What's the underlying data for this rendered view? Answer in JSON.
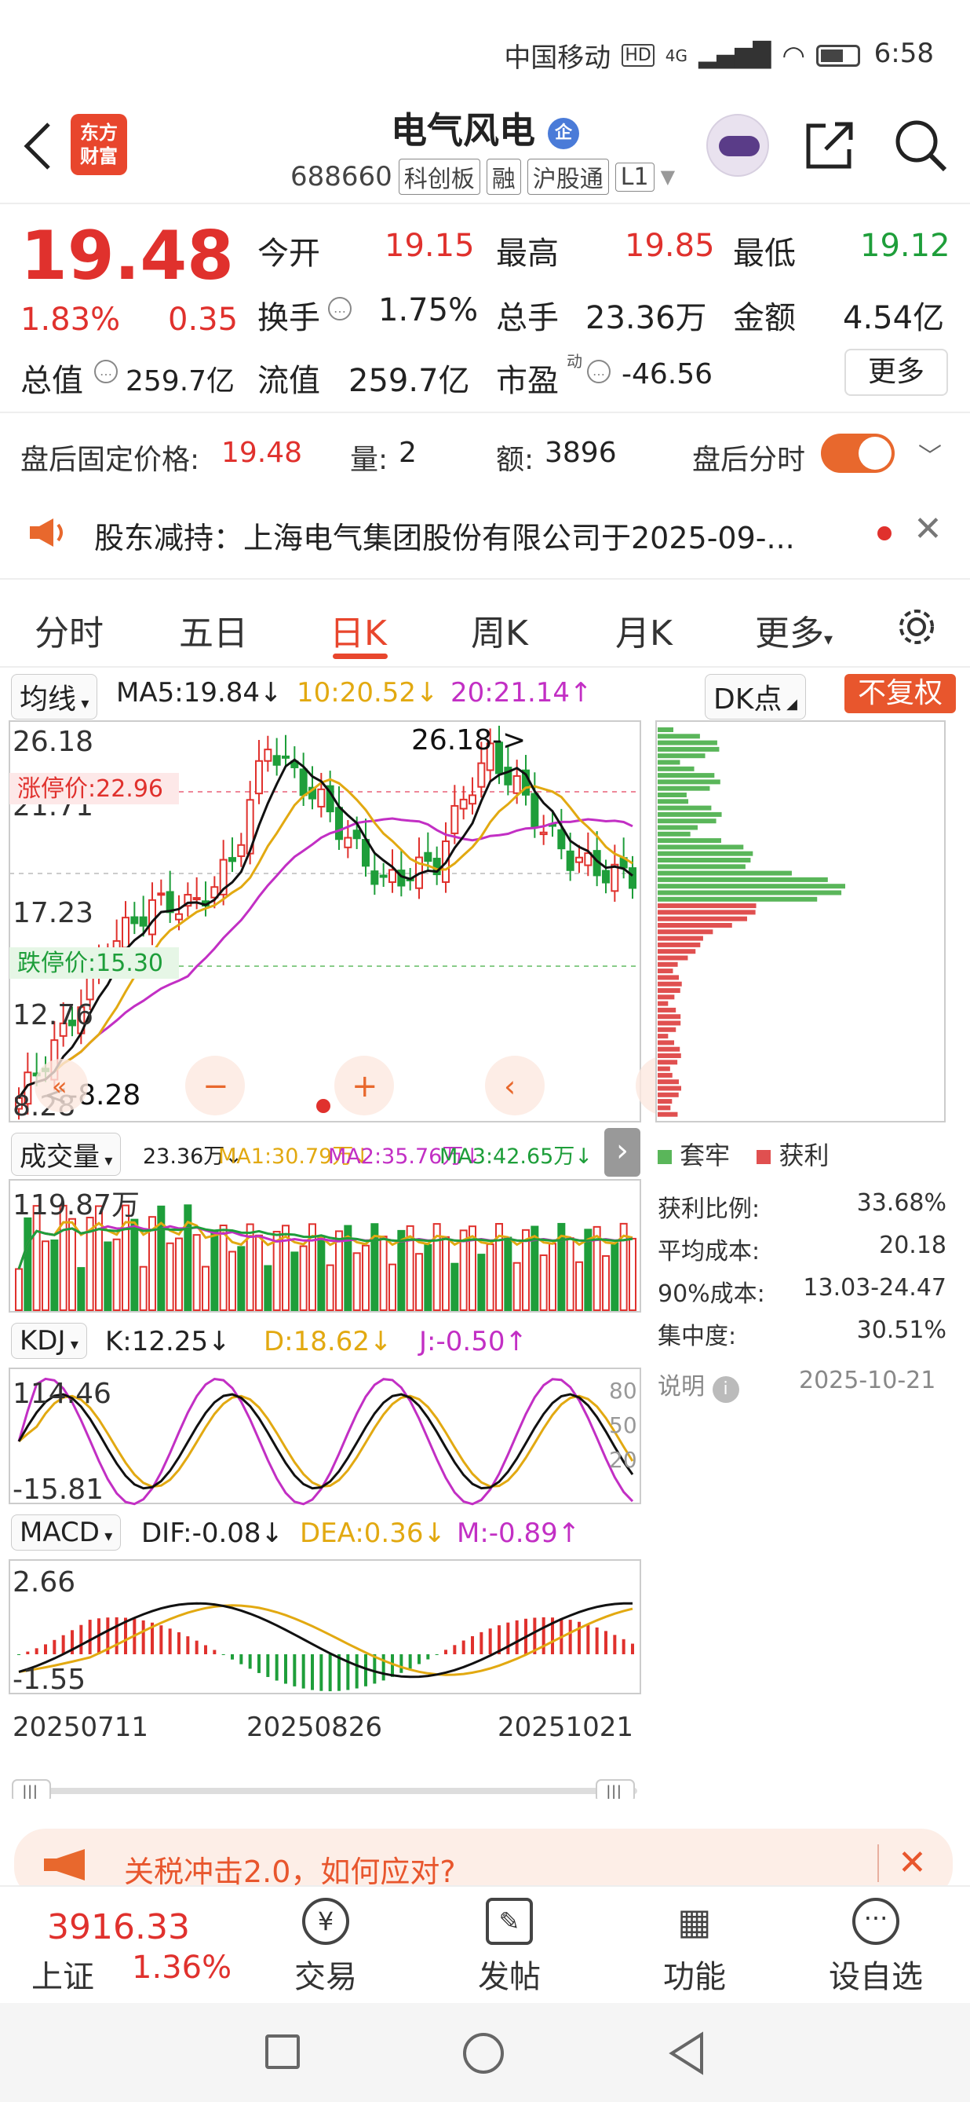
{
  "status_bar": {
    "carrier": "中国移动",
    "hd": "HD",
    "net": "4G",
    "time": "6:58"
  },
  "header": {
    "logo_text_1": "东方",
    "logo_text_2": "财富",
    "title": "电气风电",
    "badge": "企",
    "code": "688660",
    "tags": [
      "科创板",
      "融",
      "沪股通",
      "L1"
    ]
  },
  "quote": {
    "price": "19.48",
    "change_pct": "1.83%",
    "change": "0.35",
    "open_label": "今开",
    "open": "19.15",
    "high_label": "最高",
    "high": "19.85",
    "low_label": "最低",
    "low": "19.12",
    "turnover_label": "换手",
    "turnover": "1.75%",
    "volume_label": "总手",
    "volume": "23.36万",
    "amount_label": "金额",
    "amount": "4.54亿",
    "mktcap_label": "总值",
    "mktcap": "259.7亿",
    "float_label": "流值",
    "float": "259.7亿",
    "pe_label": "市盈",
    "pe_sup": "动",
    "pe": "-46.56",
    "more_button": "更多"
  },
  "after_hours": {
    "price_label": "盘后固定价格:",
    "price": "19.48",
    "vol_label": "量:",
    "vol": "2",
    "amt_label": "额:",
    "amt": "3896",
    "toggle_label": "盘后分时",
    "toggle_on": true
  },
  "notice": {
    "text": "股东减持：上海电气集团股份有限公司于2025-09-..."
  },
  "tabs": [
    "分时",
    "五日",
    "日K",
    "周K",
    "月K",
    "更多"
  ],
  "active_tab": 2,
  "kline": {
    "ma_select": "均线",
    "ma5": "MA5:19.84↓",
    "ma10": "10:20.52↓",
    "ma20": "20:21.14↑",
    "dk_button": "DK点",
    "adjust_button": "不复权",
    "y_labels": [
      "26.18",
      "21.71",
      "17.23",
      "12.76",
      "8.28"
    ],
    "peak_label": "26.18->",
    "trough_label": "<-8.28",
    "limit_up": "涨停价:22.96",
    "limit_down": "跌停价:15.30"
  },
  "volume_panel": {
    "select": "成交量",
    "vol": "23.36万↓",
    "ma1": "MA1:30.79万↓",
    "ma2": "MA2:35.76万↓",
    "ma3": "MA3:42.65万↓",
    "y_label": "119.87万"
  },
  "kdj": {
    "select": "KDJ",
    "k": "K:12.25↓",
    "d": "D:18.62↓",
    "j": "J:-0.50↑",
    "y_top": "114.46",
    "y_bottom": "-15.81",
    "levels": [
      "80",
      "50",
      "20"
    ]
  },
  "macd": {
    "select": "MACD",
    "dif": "DIF:-0.08↓",
    "dea": "DEA:0.36↓",
    "m": "M:-0.89↑",
    "y_top": "2.66",
    "y_bottom": "-1.55"
  },
  "x_dates": [
    "20250711",
    "20250826",
    "20251021"
  ],
  "chip_dist": {
    "legend_trapped": "套牢",
    "legend_profit": "获利",
    "rows": [
      {
        "label": "获利比例:",
        "value": "33.68%"
      },
      {
        "label": "平均成本:",
        "value": "20.18"
      },
      {
        "label": "90%成本:",
        "value": "13.03-24.47"
      },
      {
        "label": "集中度:",
        "value": "30.51%"
      }
    ],
    "note_label": "说明",
    "date": "2025-10-21"
  },
  "promo": {
    "text": "关税冲击2.0，如何应对?"
  },
  "bottom_nav": {
    "index_value": "3916.33",
    "index_name": "上证",
    "index_pct": "1.36%",
    "items": [
      "交易",
      "发帖",
      "功能",
      "设自选"
    ]
  },
  "colors": {
    "up": "#e0312d",
    "down": "#1e9e3a",
    "brand": "#e8462d",
    "ma5": "#111111",
    "ma10": "#e2a911",
    "ma20": "#c22fc4"
  }
}
